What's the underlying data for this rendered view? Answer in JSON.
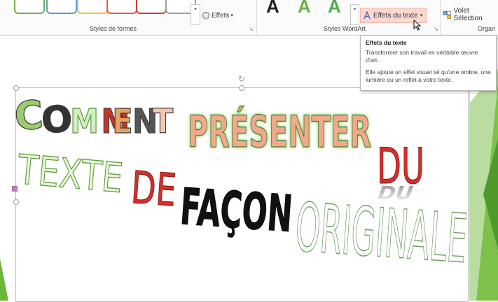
{
  "ribbon": {
    "shape_styles": {
      "swatch_colors": [
        "#6fb04d",
        "#5b9bd5",
        "#f0c330",
        "#e65a4a",
        "#d23a3a",
        "#9e9e9e"
      ],
      "more_glyph": "▾",
      "effects_label": "Effets",
      "effects_caret": "▾",
      "group_label": "Styles de formes"
    },
    "wordart_styles": {
      "letters": [
        "A",
        "A",
        "A"
      ],
      "letter_colors": [
        "#222222",
        "#6ab04c",
        "#4caf50"
      ],
      "more_glyph": "▾",
      "text_effects_label": "Effets du texte",
      "text_effects_caret": "▾",
      "group_label": "Styles WordArt"
    },
    "arrange": {
      "selection_pane_label": "Volet Sélection",
      "group_label": "Organ"
    }
  },
  "tooltip": {
    "title": "Effets du texte",
    "line1": "Transformer son travail en véritable œuvre d'art.",
    "line2": "Elle ajoute un effet visuel tel qu'une ombre, une lumière ou un reflet à votre texte."
  },
  "slide": {
    "wordart_line1_letters": [
      "C",
      "O",
      "M",
      "M",
      "E",
      "N",
      "T"
    ],
    "wordart_line1_colors": [
      "#9acd6a",
      "#333333",
      "#d0f0c0",
      "#c0392b",
      "#e8a060",
      "#555555",
      "#f4c7b0"
    ],
    "wordart_word2": "PRÉSENTER",
    "wordart_word3": "DU",
    "wordart_line2_word1": "TEXTE",
    "wordart_line2_word2": "DE",
    "wordart_line2_word3": "FAÇON",
    "wordart_line2_word4": "ORIGINALE",
    "reflection": "DU",
    "colors": {
      "green_fill": "#7ac143",
      "salmon_fill": "#f2a88a",
      "red_fill": "#d42f2a",
      "black_fill": "#111111",
      "outline_green": "#3a7a2a",
      "accent_green": "#6ab83a"
    }
  }
}
